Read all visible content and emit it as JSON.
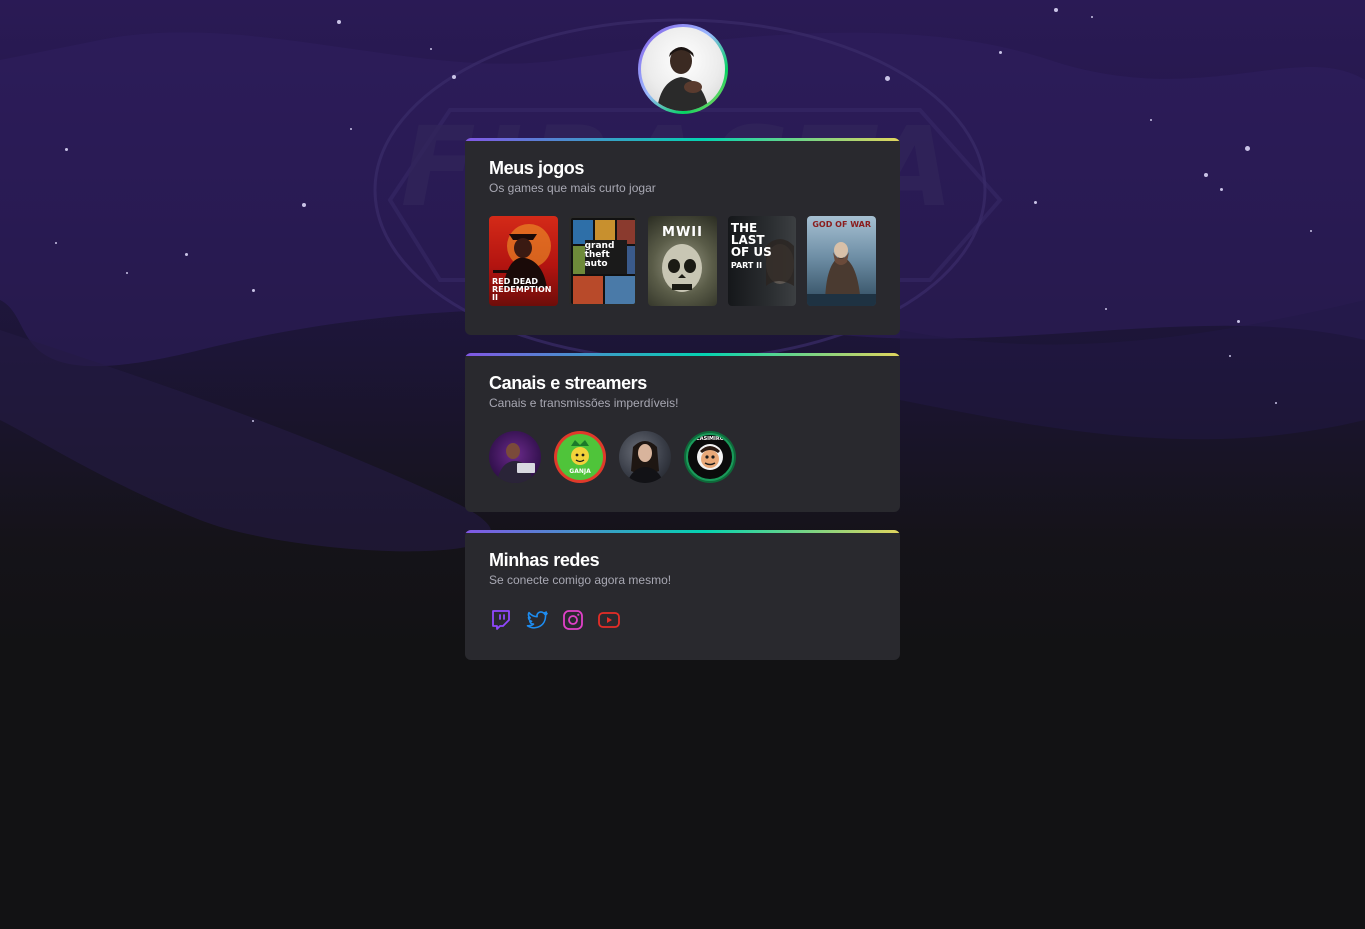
{
  "profile": {
    "avatar_alt": "profile-photo"
  },
  "sections": {
    "games": {
      "title": "Meus jogos",
      "subtitle": "Os games que mais curto jogar",
      "items": [
        {
          "name": "Red Dead Redemption II",
          "label_lines": [
            "RED DEAD",
            "REDEMPTION II"
          ],
          "bg": "#c51b12"
        },
        {
          "name": "Grand Theft Auto V",
          "label_lines": [
            "grand",
            "theft",
            "auto"
          ],
          "bg": "#3a3a3a"
        },
        {
          "name": "Call of Duty Modern Warfare II",
          "label_lines": [
            "MWII"
          ],
          "bg": "#4b4d3a"
        },
        {
          "name": "The Last of Us Part II",
          "label_lines": [
            "THE",
            "LAST",
            "OF US",
            "PART II"
          ],
          "bg": "#1c1e22"
        },
        {
          "name": "God of War",
          "label_lines": [
            "GOD OF WAR"
          ],
          "bg": "#6f8fa6"
        }
      ]
    },
    "streamers": {
      "title": "Canais e streamers",
      "subtitle": "Canais e transmissões imperdíveis!",
      "items": [
        {
          "name": "streamer-1"
        },
        {
          "name": "streamer-2",
          "badge": "GANJA"
        },
        {
          "name": "streamer-3"
        },
        {
          "name": "streamer-4",
          "badge": "CASIMIRO"
        }
      ]
    },
    "networks": {
      "title": "Minhas redes",
      "subtitle": "Se conecte comigo agora mesmo!",
      "items": [
        {
          "name": "twitch",
          "color": "#9147ff"
        },
        {
          "name": "twitter",
          "color": "#1d8cf0"
        },
        {
          "name": "instagram",
          "color": "#e040c8"
        },
        {
          "name": "youtube",
          "color": "#e52d27"
        }
      ]
    }
  },
  "colors": {
    "background": "#121214",
    "card": "#29292e",
    "accent_purple": "#8257e5",
    "accent_green": "#04d3b1",
    "accent_yellow": "#e1d55d"
  }
}
